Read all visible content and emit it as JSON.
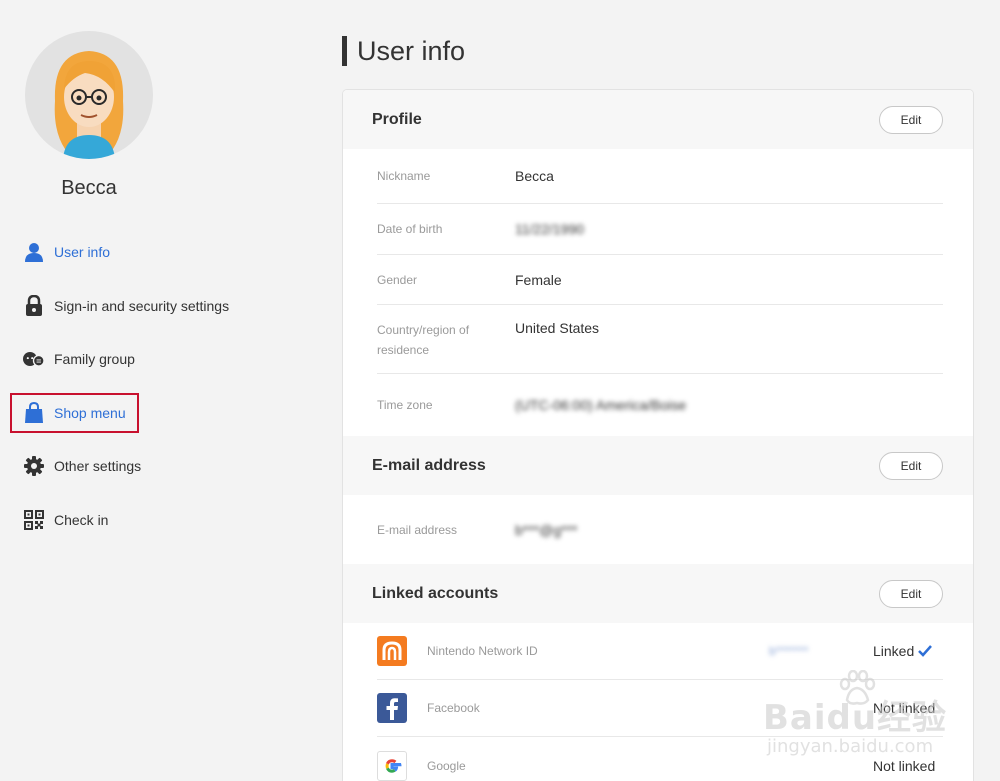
{
  "user": {
    "name": "Becca"
  },
  "sidebar": {
    "items": [
      {
        "label": "User info",
        "icon": "person-icon"
      },
      {
        "label": "Sign-in and security settings",
        "icon": "lock-icon"
      },
      {
        "label": "Family group",
        "icon": "family-icon"
      },
      {
        "label": "Shop menu",
        "icon": "shopping-bag-icon"
      },
      {
        "label": "Other settings",
        "icon": "gear-icon"
      },
      {
        "label": "Check in",
        "icon": "qr-code-icon"
      }
    ]
  },
  "page": {
    "title": "User info"
  },
  "profile": {
    "title": "Profile",
    "edit_label": "Edit",
    "rows": [
      {
        "label": "Nickname",
        "value": "Becca"
      },
      {
        "label": "Date of birth",
        "value": "11/22/1990"
      },
      {
        "label": "Gender",
        "value": "Female"
      },
      {
        "label": "Country/region of residence",
        "value": "United States"
      },
      {
        "label": "Time zone",
        "value": "(UTC-06:00) America/Boise"
      }
    ]
  },
  "email": {
    "title": "E-mail address",
    "edit_label": "Edit",
    "rows": [
      {
        "label": "E-mail address",
        "value": "b***@g***"
      }
    ]
  },
  "linked": {
    "title": "Linked accounts",
    "edit_label": "Edit",
    "rows": [
      {
        "name": "Nintendo Network ID",
        "id": "b*******",
        "status": "Linked"
      },
      {
        "name": "Facebook",
        "id": "",
        "status": "Not linked"
      },
      {
        "name": "Google",
        "id": "",
        "status": "Not linked"
      }
    ]
  },
  "watermark": {
    "big": "Baidu经验",
    "small": "jingyan.baidu.com"
  },
  "colors": {
    "accent": "#2e6fd6",
    "highlight": "#c8102e",
    "nintendo": "#f47b20",
    "facebook": "#3b5998"
  }
}
